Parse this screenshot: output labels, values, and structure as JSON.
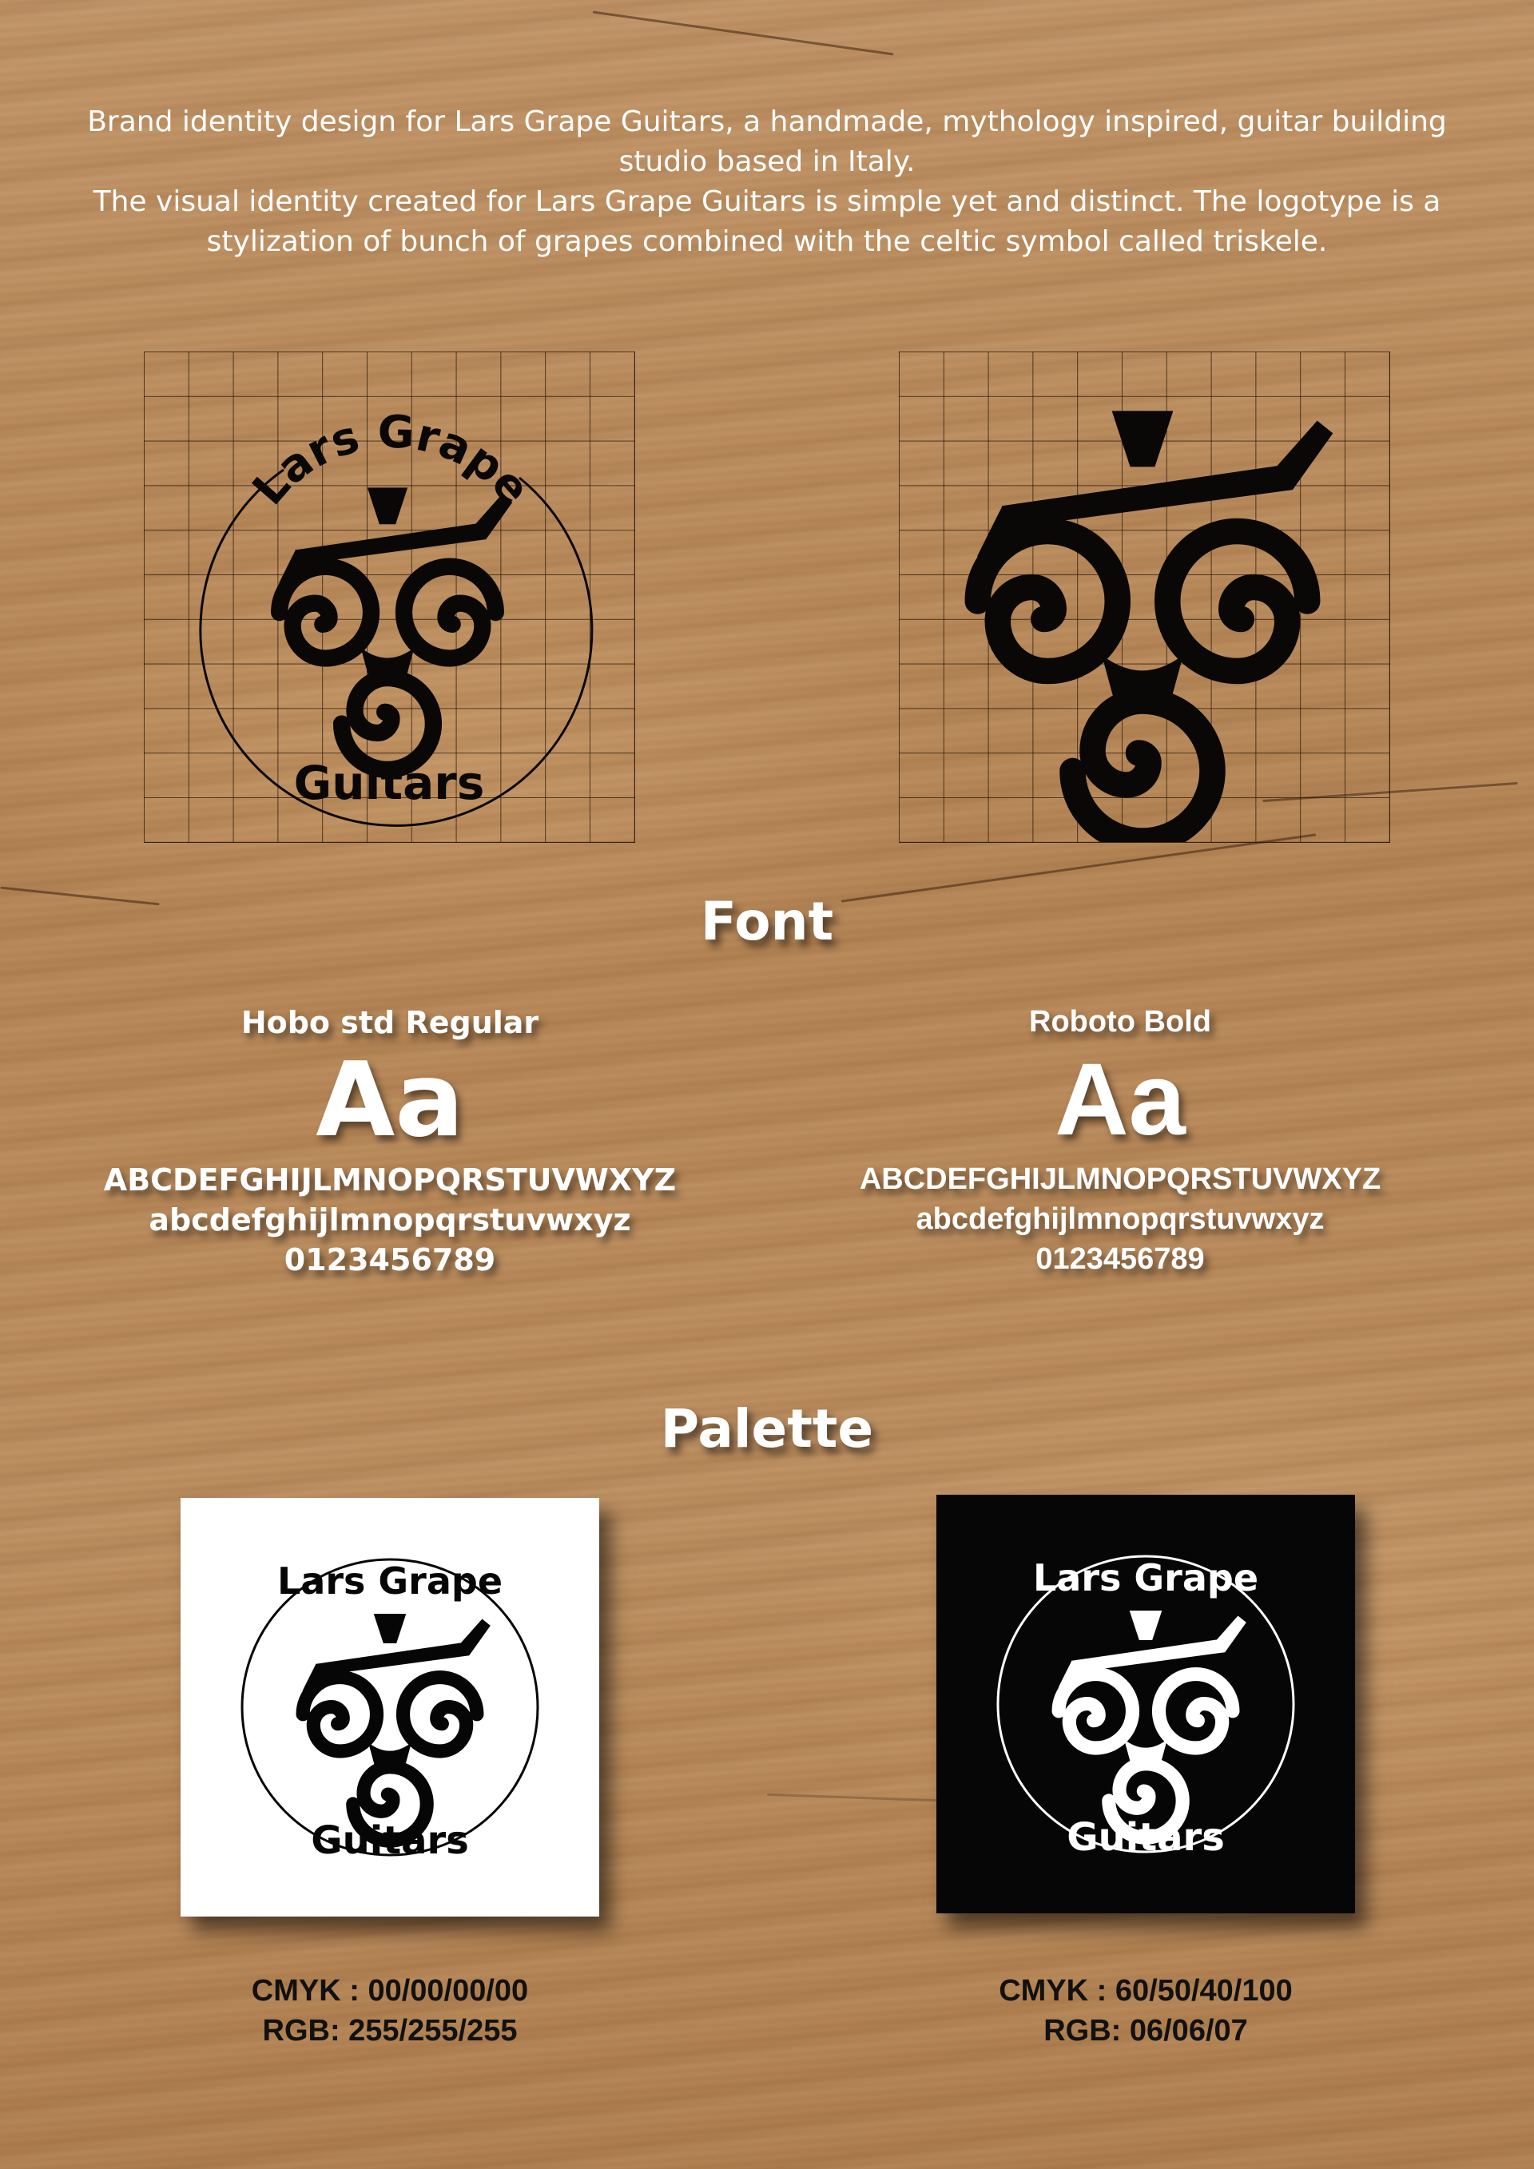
{
  "intro": {
    "line1": "Brand identity design for Lars Grape Guitars, a handmade, mythology inspired, guitar building studio based in Italy.",
    "line2": "The visual identity created for Lars Grape Guitars is simple yet and distinct. The logotype is a stylization of bunch of grapes combined with the celtic symbol called triskele."
  },
  "logo": {
    "top_text": "Lars Grape",
    "bottom_text": "Guitars"
  },
  "font_section": {
    "title": "Font",
    "fonts": [
      {
        "name": "Hobo std Regular",
        "sample": "Aa",
        "uppercase": "ABCDEFGHIJLMNOPQRSTUVWXYZ",
        "lowercase": "abcdefghijlmnopqrstuvwxyz",
        "digits": "0123456789"
      },
      {
        "name": "Roboto Bold",
        "sample": "Aa",
        "uppercase": "ABCDEFGHIJLMNOPQRSTUVWXYZ",
        "lowercase": "abcdefghijlmnopqrstuvwxyz",
        "digits": "0123456789"
      }
    ]
  },
  "palette_section": {
    "title": "Palette",
    "swatches": [
      {
        "cmyk": "CMYK : 00/00/00/00",
        "rgb": "RGB:  255/255/255",
        "background": "#ffffff",
        "foreground": "#060607"
      },
      {
        "cmyk": "CMYK : 60/50/40/100",
        "rgb": "RGB:  06/06/07",
        "background": "#060607",
        "foreground": "#ffffff"
      }
    ]
  }
}
